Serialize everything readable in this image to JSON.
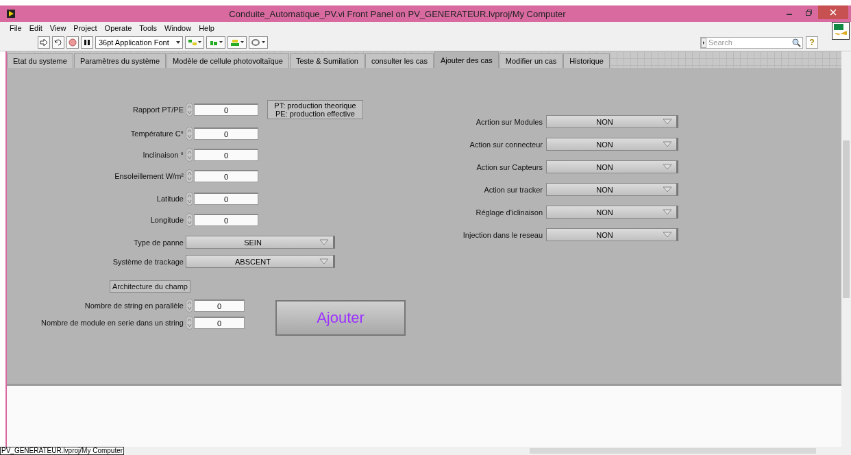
{
  "window": {
    "title": "Conduite_Automatique_PV.vi Front Panel on PV_GENERATEUR.lvproj/My Computer"
  },
  "menu": [
    "File",
    "Edit",
    "View",
    "Project",
    "Operate",
    "Tools",
    "Window",
    "Help"
  ],
  "toolbar": {
    "font": "36pt Application Font",
    "search": {
      "placeholder": "Search"
    },
    "help": "?"
  },
  "tabs": [
    {
      "label": "Etat du systeme",
      "selected": false
    },
    {
      "label": "Paramètres du système",
      "selected": false
    },
    {
      "label": "Modèle de cellule photovoltaïque",
      "selected": false
    },
    {
      "label": "Teste & Sumilation",
      "selected": false
    },
    {
      "label": "consulter les cas",
      "selected": false
    },
    {
      "label": "Ajouter des cas",
      "selected": true
    },
    {
      "label": "Modifier un cas",
      "selected": false
    },
    {
      "label": "Historique",
      "selected": false
    }
  ],
  "inputs": [
    {
      "label": "Rapport  PT/PE",
      "value": "0"
    },
    {
      "label": "Température C°",
      "value": "0"
    },
    {
      "label": "Inclinaison °",
      "value": "0"
    },
    {
      "label": "Ensoleillement W/m²",
      "value": "0"
    },
    {
      "label": "Latitude",
      "value": "0"
    },
    {
      "label": "Longitude",
      "value": "0"
    }
  ],
  "note": [
    "PT: production theorique",
    "PE: production effective"
  ],
  "selectors": [
    {
      "label": "Type de panne",
      "value": "SEIN"
    },
    {
      "label": "Système de trackage",
      "value": "ABSCENT"
    }
  ],
  "architecture": {
    "title": "Architecture du champ",
    "inputs": [
      {
        "label": "Nombre de string en parallèle",
        "value": "0"
      },
      {
        "label": "Nombre de module en serie dans un string",
        "value": "0"
      }
    ]
  },
  "actions": [
    {
      "label": "Acrtion sur Modules",
      "value": "NON"
    },
    {
      "label": "Action sur connecteur",
      "value": "NON"
    },
    {
      "label": "Action sur Capteurs",
      "value": "NON"
    },
    {
      "label": "Action sur tracker",
      "value": "NON"
    },
    {
      "label": "Réglage d'iclinaison",
      "value": "NON"
    },
    {
      "label": "Injection dans le reseau",
      "value": "NON"
    }
  ],
  "submit": "Ajouter",
  "status_bar": {
    "path": "PV_GENERATEUR.lvproj/My Computer"
  }
}
